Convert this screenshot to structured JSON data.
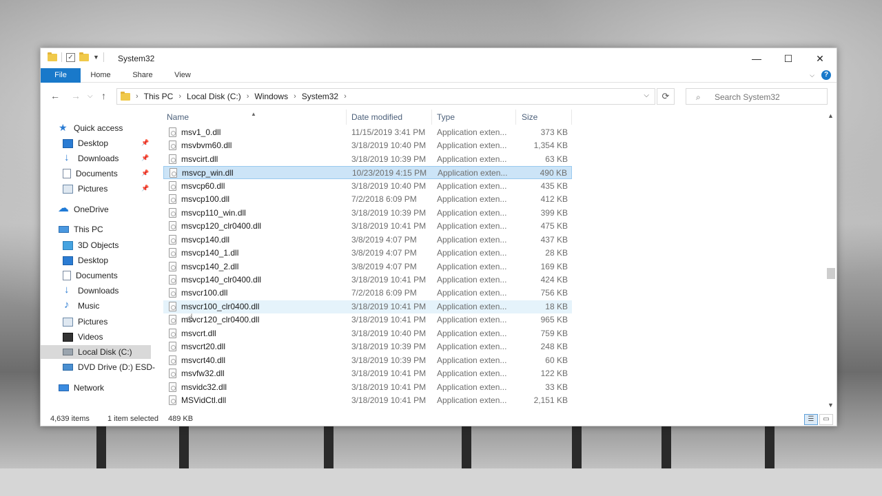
{
  "window": {
    "title": "System32",
    "tabs": [
      "File",
      "Home",
      "Share",
      "View"
    ],
    "controls": {
      "minimize": "—",
      "maximize": "☐",
      "close": "✕"
    }
  },
  "address": {
    "crumbs": [
      "This PC",
      "Local Disk (C:)",
      "Windows",
      "System32"
    ],
    "search_placeholder": "Search System32"
  },
  "sidebar": {
    "quick_access": "Quick access",
    "quick_items": [
      "Desktop",
      "Downloads",
      "Documents",
      "Pictures"
    ],
    "onedrive": "OneDrive",
    "this_pc": "This PC",
    "pc_items": [
      "3D Objects",
      "Desktop",
      "Documents",
      "Downloads",
      "Music",
      "Pictures",
      "Videos",
      "Local Disk (C:)",
      "DVD Drive (D:) ESD-"
    ],
    "network": "Network"
  },
  "columns": {
    "name": "Name",
    "date": "Date modified",
    "type": "Type",
    "size": "Size"
  },
  "files": [
    {
      "name": "msv1_0.dll",
      "date": "11/15/2019 3:41 PM",
      "type": "Application exten...",
      "size": "373 KB"
    },
    {
      "name": "msvbvm60.dll",
      "date": "3/18/2019 10:40 PM",
      "type": "Application exten...",
      "size": "1,354 KB"
    },
    {
      "name": "msvcirt.dll",
      "date": "3/18/2019 10:39 PM",
      "type": "Application exten...",
      "size": "63 KB"
    },
    {
      "name": "msvcp_win.dll",
      "date": "10/23/2019 4:15 PM",
      "type": "Application exten...",
      "size": "490 KB"
    },
    {
      "name": "msvcp60.dll",
      "date": "3/18/2019 10:40 PM",
      "type": "Application exten...",
      "size": "435 KB"
    },
    {
      "name": "msvcp100.dll",
      "date": "7/2/2018 6:09 PM",
      "type": "Application exten...",
      "size": "412 KB"
    },
    {
      "name": "msvcp110_win.dll",
      "date": "3/18/2019 10:39 PM",
      "type": "Application exten...",
      "size": "399 KB"
    },
    {
      "name": "msvcp120_clr0400.dll",
      "date": "3/18/2019 10:41 PM",
      "type": "Application exten...",
      "size": "475 KB"
    },
    {
      "name": "msvcp140.dll",
      "date": "3/8/2019 4:07 PM",
      "type": "Application exten...",
      "size": "437 KB"
    },
    {
      "name": "msvcp140_1.dll",
      "date": "3/8/2019 4:07 PM",
      "type": "Application exten...",
      "size": "28 KB"
    },
    {
      "name": "msvcp140_2.dll",
      "date": "3/8/2019 4:07 PM",
      "type": "Application exten...",
      "size": "169 KB"
    },
    {
      "name": "msvcp140_clr0400.dll",
      "date": "3/18/2019 10:41 PM",
      "type": "Application exten...",
      "size": "424 KB"
    },
    {
      "name": "msvcr100.dll",
      "date": "7/2/2018 6:09 PM",
      "type": "Application exten...",
      "size": "756 KB"
    },
    {
      "name": "msvcr100_clr0400.dll",
      "date": "3/18/2019 10:41 PM",
      "type": "Application exten...",
      "size": "18 KB"
    },
    {
      "name": "msvcr120_clr0400.dll",
      "date": "3/18/2019 10:41 PM",
      "type": "Application exten...",
      "size": "965 KB"
    },
    {
      "name": "msvcrt.dll",
      "date": "3/18/2019 10:40 PM",
      "type": "Application exten...",
      "size": "759 KB"
    },
    {
      "name": "msvcrt20.dll",
      "date": "3/18/2019 10:39 PM",
      "type": "Application exten...",
      "size": "248 KB"
    },
    {
      "name": "msvcrt40.dll",
      "date": "3/18/2019 10:39 PM",
      "type": "Application exten...",
      "size": "60 KB"
    },
    {
      "name": "msvfw32.dll",
      "date": "3/18/2019 10:41 PM",
      "type": "Application exten...",
      "size": "122 KB"
    },
    {
      "name": "msvidc32.dll",
      "date": "3/18/2019 10:41 PM",
      "type": "Application exten...",
      "size": "33 KB"
    },
    {
      "name": "MSVidCtl.dll",
      "date": "3/18/2019 10:41 PM",
      "type": "Application exten...",
      "size": "2,151 KB"
    }
  ],
  "selected_file": "msvcp_win.dll",
  "hovered_file": "msvcr100_clr0400.dll",
  "status": {
    "count": "4,639 items",
    "selected": "1 item selected",
    "size": "489 KB"
  },
  "colors": {
    "accent": "#1979ca",
    "selection": "#cce4f7",
    "hover": "#e5f3fb"
  }
}
